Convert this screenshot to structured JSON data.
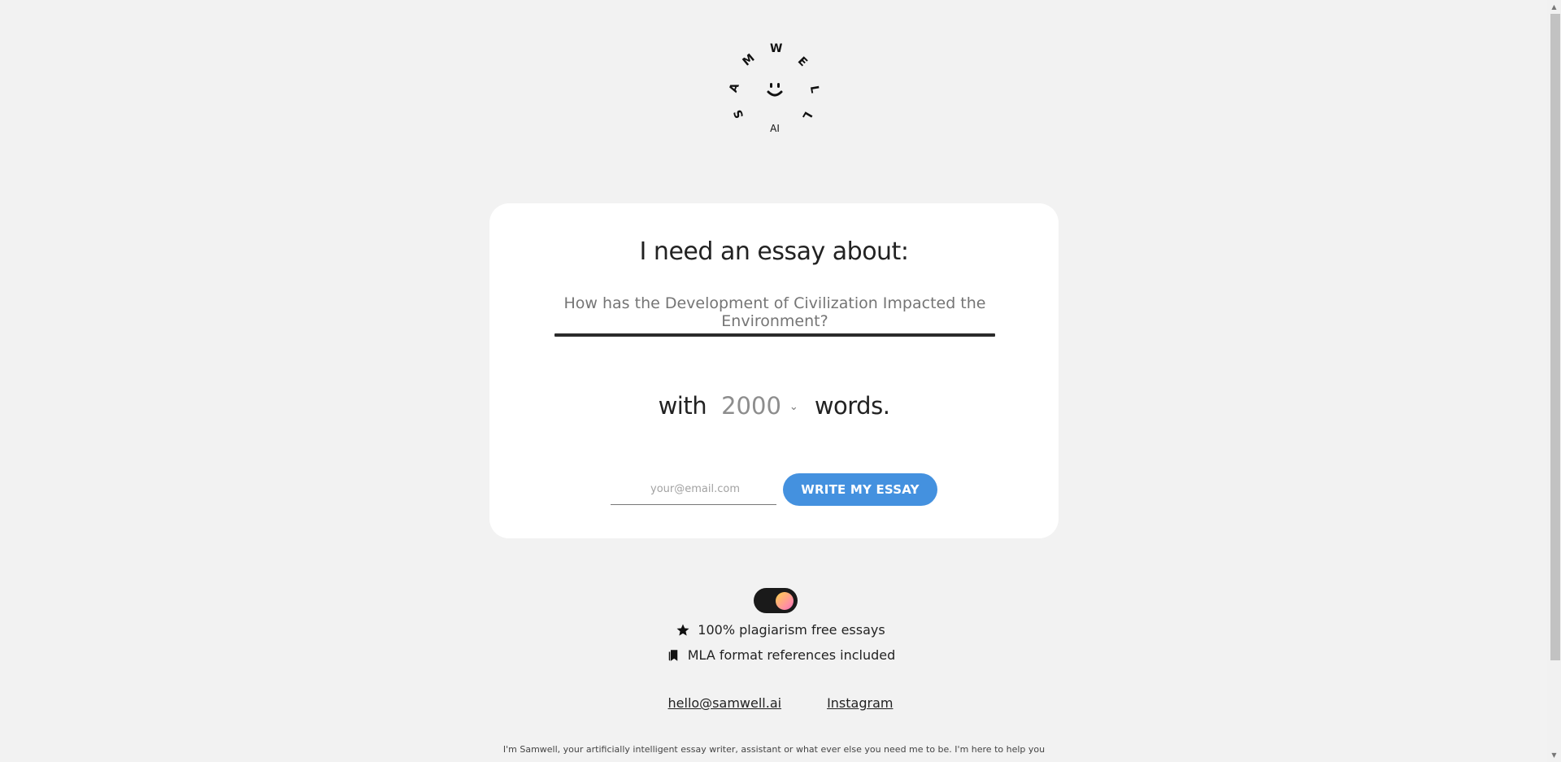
{
  "logo": {
    "letters": [
      "S",
      "A",
      "M",
      "W",
      "E",
      "L",
      "L"
    ],
    "sub": "AI"
  },
  "card": {
    "title": "I need an essay about:",
    "topic_placeholder": "How has the Development of Civilization Impacted the Environment?",
    "with_label": "with",
    "words_value": "2000",
    "words_label": "words.",
    "email_placeholder": "your@email.com",
    "submit_label": "WRITE MY ESSAY",
    "accent_color": "#4491df"
  },
  "toggle": {
    "state": "on"
  },
  "features": [
    {
      "icon": "star-icon",
      "text": "100% plagiarism free essays"
    },
    {
      "icon": "bookmarks-icon",
      "text": "MLA format references included"
    }
  ],
  "links": {
    "email": "hello@samwell.ai",
    "instagram": "Instagram"
  },
  "about": "I'm Samwell, your artificially intelligent essay writer, assistant or what ever else you need me to be. I'm here to help you"
}
